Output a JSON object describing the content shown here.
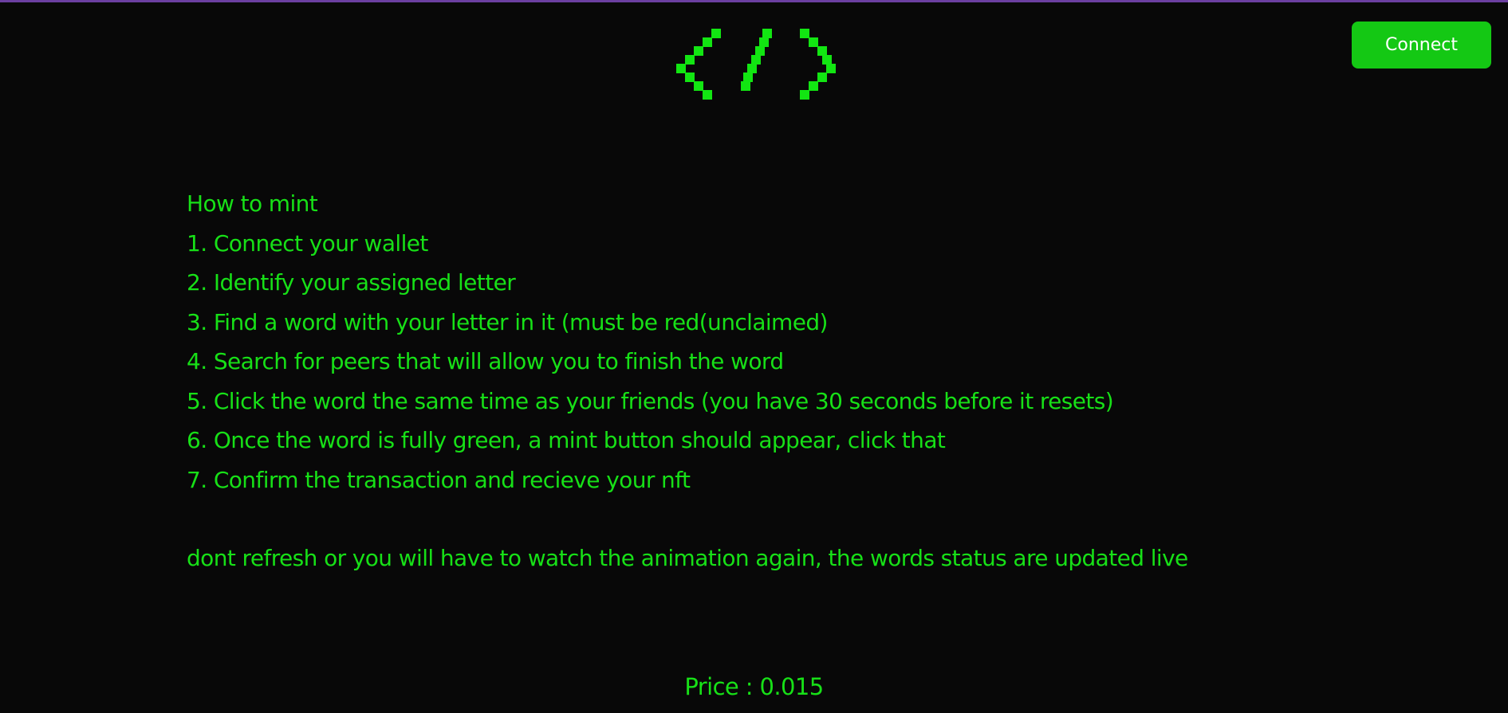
{
  "logo": {
    "icon": "code-brackets-icon"
  },
  "header": {
    "connect_label": "Connect"
  },
  "instructions": {
    "title": "How to mint",
    "steps": [
      "1. Connect your wallet",
      "2. Identify your assigned letter",
      "3. Find a word with your letter in it (must be red(unclaimed)",
      "4. Search for peers that will allow you to finish the word",
      "5. Click the word the same time as your friends (you have 30 seconds before it resets)",
      "6. Once the word is fully green, a mint button should appear, click that",
      "7. Confirm the transaction and recieve your nft"
    ],
    "note": "dont refresh or you will have to watch the animation again, the words status are updated live"
  },
  "price": {
    "text": "Price : 0.015"
  },
  "colors": {
    "background": "#080808",
    "accent_green": "#17e017",
    "button_green": "#14c814",
    "top_border": "#6b3fa0"
  }
}
